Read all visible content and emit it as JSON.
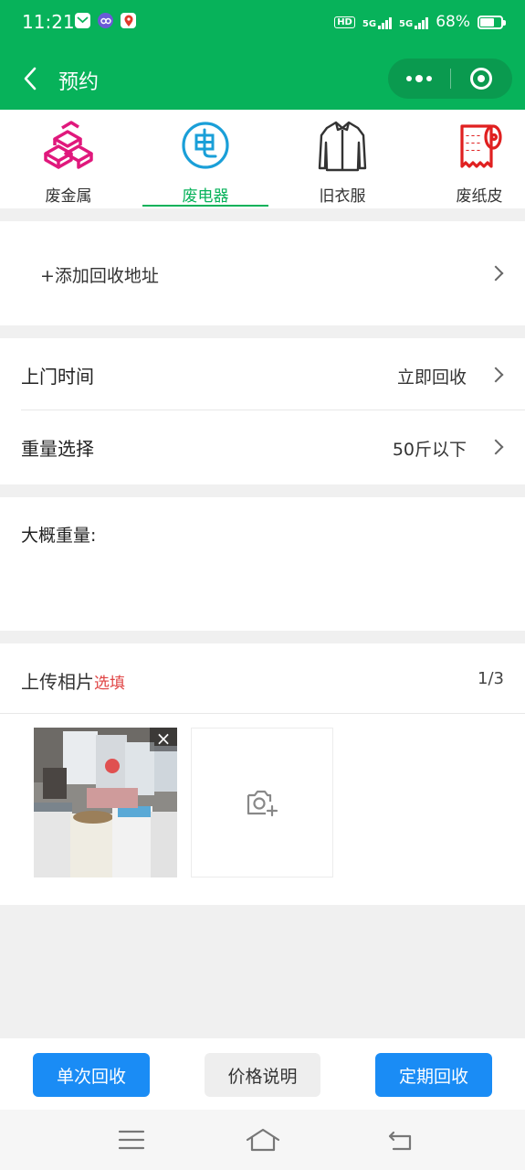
{
  "status_bar": {
    "time": "11:21",
    "hd": "HD",
    "signal_1": "5G",
    "signal_2": "5G",
    "battery": "68%",
    "battery_level": 0.68
  },
  "nav": {
    "title": "预约",
    "back_icon": "chevron-left-icon",
    "more_icon": "more-dots-icon",
    "close_icon": "target-ring-icon"
  },
  "categories": [
    {
      "label": "废金属",
      "icon": "metal-bars-icon",
      "color": "#e0187c"
    },
    {
      "label": "废电器",
      "icon": "electric-circle-icon",
      "color": "#1a9fd8",
      "active": true
    },
    {
      "label": "旧衣服",
      "icon": "shirt-icon",
      "color": "#333333"
    },
    {
      "label": "废纸皮",
      "icon": "paper-roll-icon",
      "color": "#e02020"
    }
  ],
  "address": {
    "label": "+添加回收地址"
  },
  "visit_time": {
    "label": "上门时间",
    "value": "立即回收"
  },
  "weight_select": {
    "label": "重量选择",
    "value": "50斤以下"
  },
  "approx_weight": {
    "label": "大概重量:"
  },
  "upload": {
    "label": "上传相片",
    "optional": "选填",
    "count": "1/3",
    "close": "×"
  },
  "actions": {
    "single": "单次回收",
    "price": "价格说明",
    "regular": "定期回收"
  },
  "colors": {
    "brand": "#07b25a",
    "primary_button": "#1a8cf5",
    "optional_text": "#e04444"
  }
}
